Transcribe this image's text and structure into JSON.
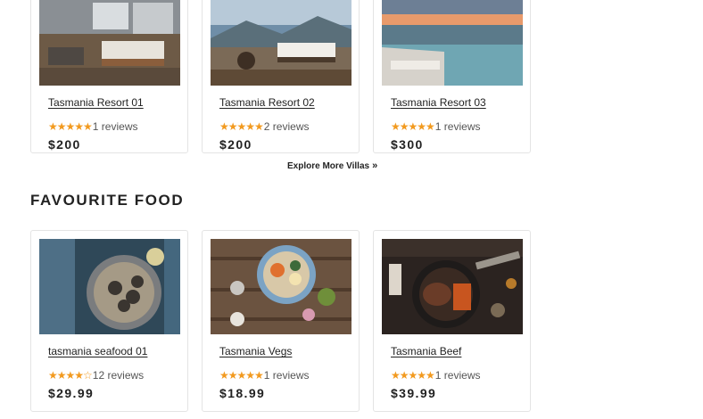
{
  "villas": [
    {
      "title": "Tasmania Resort 01",
      "stars": "★★★★★",
      "reviews": "1 reviews",
      "price": "$200"
    },
    {
      "title": "Tasmania Resort 02",
      "stars": "★★★★★",
      "reviews": "2 reviews",
      "price": "$200"
    },
    {
      "title": "Tasmania Resort 03",
      "stars": "★★★★★",
      "reviews": "1 reviews",
      "price": "$300"
    }
  ],
  "explore_label": "Explore More Villas",
  "explore_icon": "double-chevron-right-icon",
  "food_section_title": "FAVOURITE FOOD",
  "foods": [
    {
      "title": "tasmania seafood 01",
      "stars": "★★★★",
      "stars_empty": "☆",
      "reviews": "12 reviews",
      "price": "$29.99"
    },
    {
      "title": "Tasmania Vegs",
      "stars": "★★★★★",
      "reviews": "1 reviews",
      "price": "$18.99"
    },
    {
      "title": "Tasmania Beef",
      "stars": "★★★★★",
      "reviews": "1 reviews",
      "price": "$39.99"
    }
  ],
  "colors": {
    "star": "#f29a1f",
    "text": "#222222",
    "border": "#e4e4e4"
  }
}
